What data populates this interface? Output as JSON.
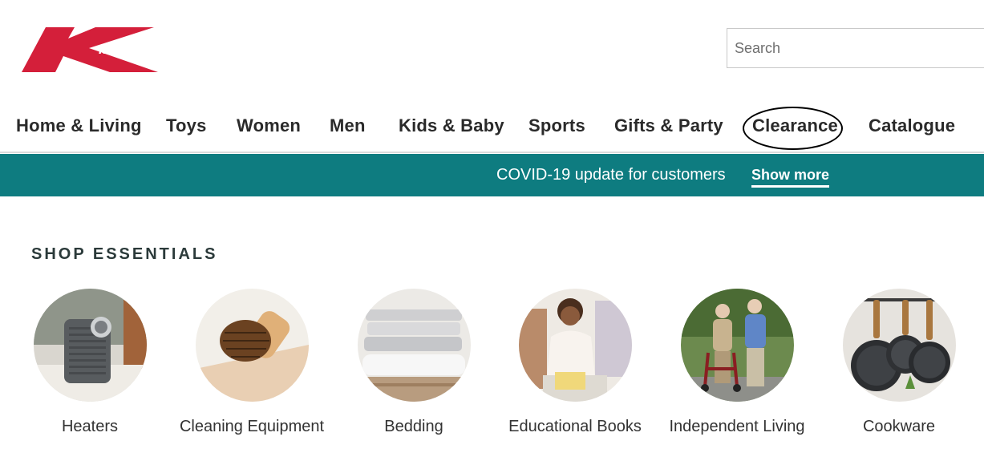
{
  "header": {
    "logo_text": "kmart",
    "search": {
      "placeholder": "Search",
      "value": ""
    }
  },
  "nav": {
    "items": [
      {
        "label": "Home & Living"
      },
      {
        "label": "Toys"
      },
      {
        "label": "Women"
      },
      {
        "label": "Men"
      },
      {
        "label": "Kids & Baby"
      },
      {
        "label": "Sports"
      },
      {
        "label": "Gifts & Party"
      },
      {
        "label": "Clearance"
      },
      {
        "label": "Catalogue"
      }
    ]
  },
  "banner": {
    "text": "COVID-19 update for customers",
    "link_label": "Show more",
    "color": "#0e7c80"
  },
  "essentials": {
    "title": "SHOP ESSENTIALS",
    "categories": [
      {
        "label": "Heaters",
        "icon": "heater-image"
      },
      {
        "label": "Cleaning Equipment",
        "icon": "brush-image"
      },
      {
        "label": "Bedding",
        "icon": "bedding-image"
      },
      {
        "label": "Educational Books",
        "icon": "child-reading-image"
      },
      {
        "label": "Independent Living",
        "icon": "walker-image"
      },
      {
        "label": "Cookware",
        "icon": "pans-image"
      }
    ]
  },
  "colors": {
    "brand_red": "#d41f3a",
    "teal": "#0e7c80"
  }
}
